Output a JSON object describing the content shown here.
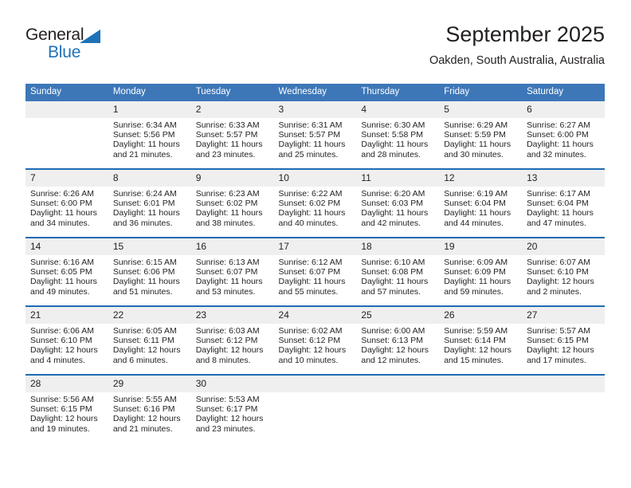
{
  "brand": {
    "name_part1": "General",
    "name_part2": "Blue",
    "triangle_color": "#1e72b8"
  },
  "header": {
    "title": "September 2025",
    "subtitle": "Oakden, South Australia, Australia"
  },
  "calendar": {
    "header_bg": "#3d77b8",
    "separator_color": "#1e6cb4",
    "daynum_bg": "#efefef",
    "weekdays": [
      "Sunday",
      "Monday",
      "Tuesday",
      "Wednesday",
      "Thursday",
      "Friday",
      "Saturday"
    ],
    "weeks": [
      [
        {
          "day": "",
          "lines": []
        },
        {
          "day": "1",
          "lines": [
            "Sunrise: 6:34 AM",
            "Sunset: 5:56 PM",
            "Daylight: 11 hours",
            "and 21 minutes."
          ]
        },
        {
          "day": "2",
          "lines": [
            "Sunrise: 6:33 AM",
            "Sunset: 5:57 PM",
            "Daylight: 11 hours",
            "and 23 minutes."
          ]
        },
        {
          "day": "3",
          "lines": [
            "Sunrise: 6:31 AM",
            "Sunset: 5:57 PM",
            "Daylight: 11 hours",
            "and 25 minutes."
          ]
        },
        {
          "day": "4",
          "lines": [
            "Sunrise: 6:30 AM",
            "Sunset: 5:58 PM",
            "Daylight: 11 hours",
            "and 28 minutes."
          ]
        },
        {
          "day": "5",
          "lines": [
            "Sunrise: 6:29 AM",
            "Sunset: 5:59 PM",
            "Daylight: 11 hours",
            "and 30 minutes."
          ]
        },
        {
          "day": "6",
          "lines": [
            "Sunrise: 6:27 AM",
            "Sunset: 6:00 PM",
            "Daylight: 11 hours",
            "and 32 minutes."
          ]
        }
      ],
      [
        {
          "day": "7",
          "lines": [
            "Sunrise: 6:26 AM",
            "Sunset: 6:00 PM",
            "Daylight: 11 hours",
            "and 34 minutes."
          ]
        },
        {
          "day": "8",
          "lines": [
            "Sunrise: 6:24 AM",
            "Sunset: 6:01 PM",
            "Daylight: 11 hours",
            "and 36 minutes."
          ]
        },
        {
          "day": "9",
          "lines": [
            "Sunrise: 6:23 AM",
            "Sunset: 6:02 PM",
            "Daylight: 11 hours",
            "and 38 minutes."
          ]
        },
        {
          "day": "10",
          "lines": [
            "Sunrise: 6:22 AM",
            "Sunset: 6:02 PM",
            "Daylight: 11 hours",
            "and 40 minutes."
          ]
        },
        {
          "day": "11",
          "lines": [
            "Sunrise: 6:20 AM",
            "Sunset: 6:03 PM",
            "Daylight: 11 hours",
            "and 42 minutes."
          ]
        },
        {
          "day": "12",
          "lines": [
            "Sunrise: 6:19 AM",
            "Sunset: 6:04 PM",
            "Daylight: 11 hours",
            "and 44 minutes."
          ]
        },
        {
          "day": "13",
          "lines": [
            "Sunrise: 6:17 AM",
            "Sunset: 6:04 PM",
            "Daylight: 11 hours",
            "and 47 minutes."
          ]
        }
      ],
      [
        {
          "day": "14",
          "lines": [
            "Sunrise: 6:16 AM",
            "Sunset: 6:05 PM",
            "Daylight: 11 hours",
            "and 49 minutes."
          ]
        },
        {
          "day": "15",
          "lines": [
            "Sunrise: 6:15 AM",
            "Sunset: 6:06 PM",
            "Daylight: 11 hours",
            "and 51 minutes."
          ]
        },
        {
          "day": "16",
          "lines": [
            "Sunrise: 6:13 AM",
            "Sunset: 6:07 PM",
            "Daylight: 11 hours",
            "and 53 minutes."
          ]
        },
        {
          "day": "17",
          "lines": [
            "Sunrise: 6:12 AM",
            "Sunset: 6:07 PM",
            "Daylight: 11 hours",
            "and 55 minutes."
          ]
        },
        {
          "day": "18",
          "lines": [
            "Sunrise: 6:10 AM",
            "Sunset: 6:08 PM",
            "Daylight: 11 hours",
            "and 57 minutes."
          ]
        },
        {
          "day": "19",
          "lines": [
            "Sunrise: 6:09 AM",
            "Sunset: 6:09 PM",
            "Daylight: 11 hours",
            "and 59 minutes."
          ]
        },
        {
          "day": "20",
          "lines": [
            "Sunrise: 6:07 AM",
            "Sunset: 6:10 PM",
            "Daylight: 12 hours",
            "and 2 minutes."
          ]
        }
      ],
      [
        {
          "day": "21",
          "lines": [
            "Sunrise: 6:06 AM",
            "Sunset: 6:10 PM",
            "Daylight: 12 hours",
            "and 4 minutes."
          ]
        },
        {
          "day": "22",
          "lines": [
            "Sunrise: 6:05 AM",
            "Sunset: 6:11 PM",
            "Daylight: 12 hours",
            "and 6 minutes."
          ]
        },
        {
          "day": "23",
          "lines": [
            "Sunrise: 6:03 AM",
            "Sunset: 6:12 PM",
            "Daylight: 12 hours",
            "and 8 minutes."
          ]
        },
        {
          "day": "24",
          "lines": [
            "Sunrise: 6:02 AM",
            "Sunset: 6:12 PM",
            "Daylight: 12 hours",
            "and 10 minutes."
          ]
        },
        {
          "day": "25",
          "lines": [
            "Sunrise: 6:00 AM",
            "Sunset: 6:13 PM",
            "Daylight: 12 hours",
            "and 12 minutes."
          ]
        },
        {
          "day": "26",
          "lines": [
            "Sunrise: 5:59 AM",
            "Sunset: 6:14 PM",
            "Daylight: 12 hours",
            "and 15 minutes."
          ]
        },
        {
          "day": "27",
          "lines": [
            "Sunrise: 5:57 AM",
            "Sunset: 6:15 PM",
            "Daylight: 12 hours",
            "and 17 minutes."
          ]
        }
      ],
      [
        {
          "day": "28",
          "lines": [
            "Sunrise: 5:56 AM",
            "Sunset: 6:15 PM",
            "Daylight: 12 hours",
            "and 19 minutes."
          ]
        },
        {
          "day": "29",
          "lines": [
            "Sunrise: 5:55 AM",
            "Sunset: 6:16 PM",
            "Daylight: 12 hours",
            "and 21 minutes."
          ]
        },
        {
          "day": "30",
          "lines": [
            "Sunrise: 5:53 AM",
            "Sunset: 6:17 PM",
            "Daylight: 12 hours",
            "and 23 minutes."
          ]
        },
        {
          "day": "",
          "lines": []
        },
        {
          "day": "",
          "lines": []
        },
        {
          "day": "",
          "lines": []
        },
        {
          "day": "",
          "lines": []
        }
      ]
    ]
  }
}
